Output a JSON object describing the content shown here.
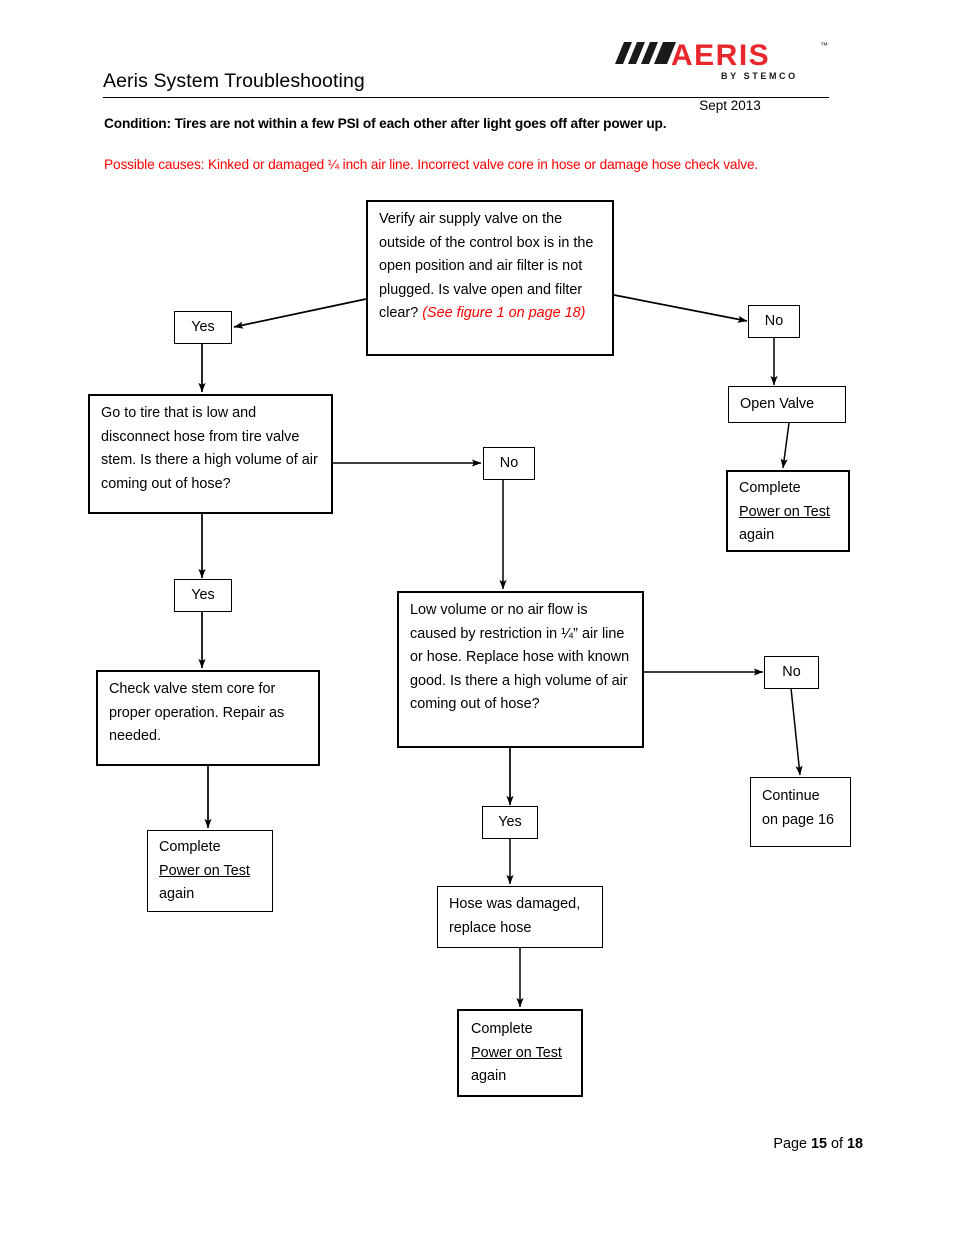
{
  "header": {
    "title": "Aeris System Troubleshooting",
    "date": "Sept 2013",
    "logo": {
      "wordmark": "AERIS",
      "tagline": "B Y   S T E M C O",
      "trademark": "™",
      "bar_color": "#1a1a1a",
      "wordmark_color": "#e8262c"
    },
    "condition": "Condition: Tires are not within a few PSI of each other after light goes off after power up.",
    "possible_causes": "Possible causes: Kinked or damaged ¼ inch air line. Incorrect valve core in hose or damage hose check valve.",
    "causes_color": "#ff0000"
  },
  "flowchart": {
    "type": "flowchart",
    "nodes": {
      "verify_valve": {
        "text_main": "Verify air supply valve on the outside of the control box is in the open position and air filter is not plugged. Is valve open and filter clear? ",
        "text_ref": "(See figure 1 on page 18)"
      },
      "yes_top": {
        "label": "Yes"
      },
      "no_top": {
        "label": "No"
      },
      "open_valve": {
        "label": "Open Valve"
      },
      "complete_right": {
        "line1": "Complete",
        "line2": "Power on Test",
        "line3": "again"
      },
      "go_to_tire": {
        "text": "Go to tire that is low and disconnect hose from tire valve stem. Is there a high volume of air coming out of hose?"
      },
      "no_mid": {
        "label": "No"
      },
      "yes_left": {
        "label": "Yes"
      },
      "check_valve_stem": {
        "text": "Check valve stem core for proper operation. Repair as needed."
      },
      "complete_left": {
        "line1": "Complete",
        "line2": "Power on Test",
        "line3": "again"
      },
      "low_volume": {
        "text": "Low volume or no air flow is caused by restriction in ¼” air line or hose. Replace hose with known good. Is there a high volume of air coming out of hose?"
      },
      "no_right": {
        "label": "No"
      },
      "continue_page": {
        "line1": "Continue",
        "line2": "on page 16"
      },
      "yes_mid": {
        "label": "Yes"
      },
      "hose_damaged": {
        "text": "Hose was damaged, replace hose"
      },
      "complete_mid": {
        "line1": "Complete",
        "line2": "Power on Test",
        "line3": "again"
      }
    },
    "edges": [
      {
        "from": "verify_valve",
        "to": "yes_top",
        "label": ""
      },
      {
        "from": "verify_valve",
        "to": "no_top",
        "label": ""
      },
      {
        "from": "yes_top",
        "to": "go_to_tire",
        "label": ""
      },
      {
        "from": "no_top",
        "to": "open_valve",
        "label": ""
      },
      {
        "from": "open_valve",
        "to": "complete_right",
        "label": ""
      },
      {
        "from": "go_to_tire",
        "to": "no_mid",
        "label": ""
      },
      {
        "from": "go_to_tire",
        "to": "yes_left",
        "label": ""
      },
      {
        "from": "yes_left",
        "to": "check_valve_stem",
        "label": ""
      },
      {
        "from": "check_valve_stem",
        "to": "complete_left",
        "label": ""
      },
      {
        "from": "no_mid",
        "to": "low_volume",
        "label": ""
      },
      {
        "from": "low_volume",
        "to": "no_right",
        "label": ""
      },
      {
        "from": "no_right",
        "to": "continue_page",
        "label": ""
      },
      {
        "from": "low_volume",
        "to": "yes_mid",
        "label": ""
      },
      {
        "from": "yes_mid",
        "to": "hose_damaged",
        "label": ""
      },
      {
        "from": "hose_damaged",
        "to": "complete_mid",
        "label": ""
      }
    ]
  },
  "footer": {
    "page_prefix": "Page ",
    "page_number": "15",
    "page_middle": " of ",
    "page_total": "18"
  }
}
